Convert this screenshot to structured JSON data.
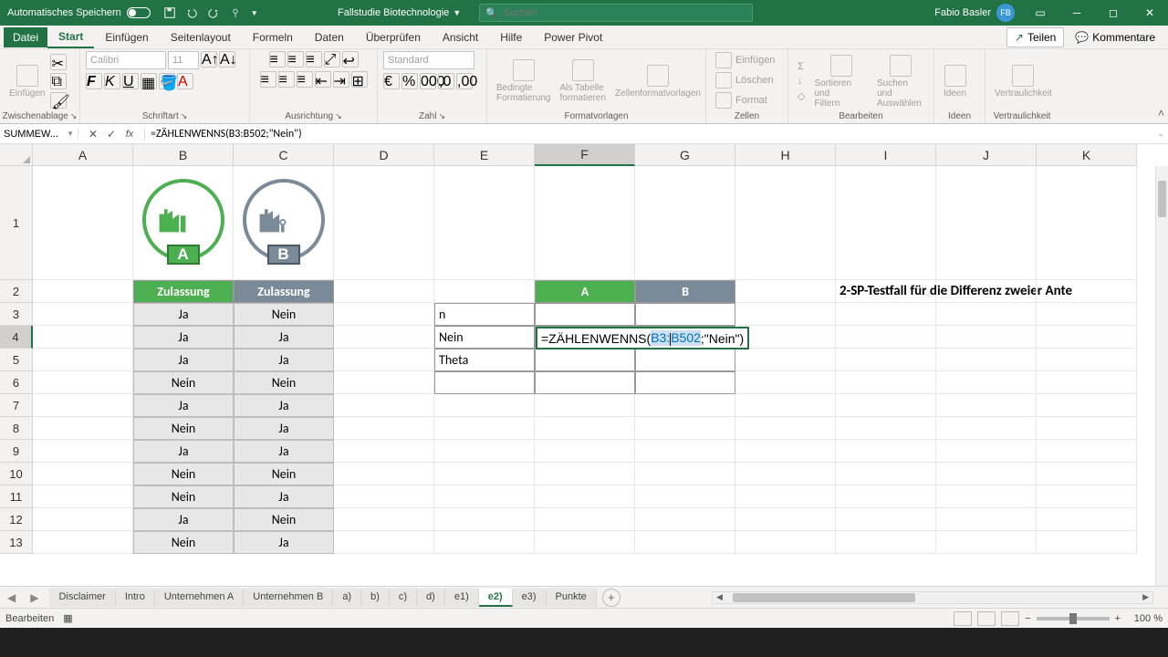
{
  "titlebar": {
    "autosave_label": "Automatisches Speichern",
    "filename": "Fallstudie Biotechnologie",
    "search_placeholder": "Suchen",
    "user_name": "Fabio Basler",
    "user_initials": "FB"
  },
  "ribbon": {
    "file": "Datei",
    "tabs": [
      "Start",
      "Einfügen",
      "Seitenlayout",
      "Formeln",
      "Daten",
      "Überprüfen",
      "Ansicht",
      "Hilfe",
      "Power Pivot"
    ],
    "active_tab": "Start",
    "share": "Teilen",
    "comments": "Kommentare",
    "groups": {
      "clipboard": {
        "label": "Zwischenablage",
        "paste": "Einfügen"
      },
      "font": {
        "label": "Schriftart",
        "name": "Calibri",
        "size": "11"
      },
      "alignment": {
        "label": "Ausrichtung"
      },
      "number": {
        "label": "Zahl",
        "format": "Standard"
      },
      "styles": {
        "label": "Formatvorlagen",
        "cond": "Bedingte\nFormatierung",
        "table": "Als Tabelle\nformatieren",
        "cell": "Zellenformatvorlagen"
      },
      "cells": {
        "label": "Zellen",
        "insert": "Einfügen",
        "delete": "Löschen",
        "format": "Format"
      },
      "editing": {
        "label": "Bearbeiten",
        "sort": "Sortieren und\nFiltern",
        "find": "Suchen und\nAuswählen"
      },
      "ideas": {
        "label": "Ideen",
        "btn": "Ideen"
      },
      "sensitivity": {
        "label": "Vertraulichkeit",
        "btn": "Vertraulichkeit"
      }
    }
  },
  "formula_bar": {
    "name_box": "SUMMEW...",
    "formula": "=ZÄHLENWENNS(B3:B502;\"Nein\")"
  },
  "sheet": {
    "columns": [
      "A",
      "B",
      "C",
      "D",
      "E",
      "F",
      "G",
      "H",
      "I",
      "J",
      "K"
    ],
    "active_col": "F",
    "rows": [
      "1",
      "2",
      "3",
      "4",
      "5",
      "6",
      "7",
      "8",
      "9",
      "10",
      "11",
      "12",
      "13"
    ],
    "active_row": "4",
    "factory_a_label": "A",
    "factory_b_label": "B",
    "header_b": "Zulassung",
    "header_c": "Zulassung",
    "data_b": [
      "Ja",
      "Ja",
      "Ja",
      "Nein",
      "Ja",
      "Nein",
      "Ja",
      "Nein",
      "Nein",
      "Ja",
      "Nein"
    ],
    "data_c": [
      "Nein",
      "Ja",
      "Ja",
      "Nein",
      "Ja",
      "Ja",
      "Ja",
      "Nein",
      "Ja",
      "Nein",
      "Ja"
    ],
    "stats_header_a": "A",
    "stats_header_b": "B",
    "stats_rows": [
      "n",
      "Nein",
      "Theta",
      ""
    ],
    "editing_formula_parts": {
      "pre": "=ZÄHLENWENNS(",
      "ref": "B3:B502",
      "post": ";\"Nein\")"
    },
    "title_text": "2-SP-Testfall für die Differenz zweier Ante"
  },
  "sheet_tabs": {
    "tabs": [
      "Disclaimer",
      "Intro",
      "Unternehmen A",
      "Unternehmen B",
      "a)",
      "b)",
      "c)",
      "d)",
      "e1)",
      "e2)",
      "e3)",
      "Punkte"
    ],
    "active": "e2)"
  },
  "statusbar": {
    "mode": "Bearbeiten",
    "zoom": "100 %"
  }
}
